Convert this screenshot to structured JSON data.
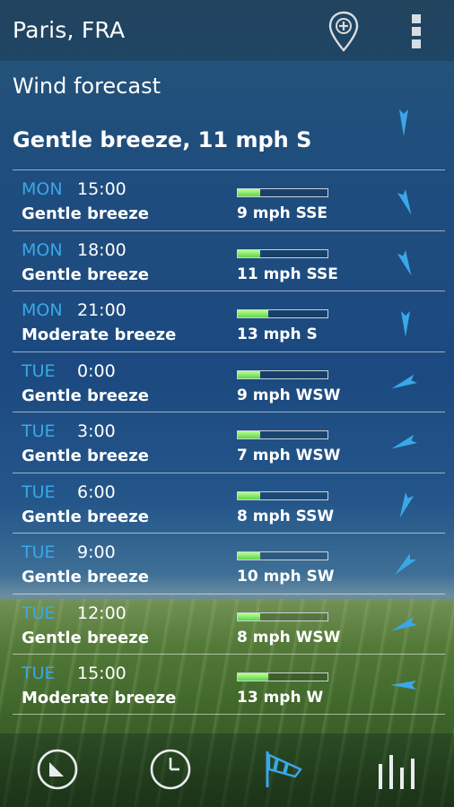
{
  "header": {
    "location": "Paris, FRA",
    "add_location_icon": "add-location-pin-icon",
    "overflow_icon": "overflow-menu-icon"
  },
  "page": {
    "title": "Wind forecast",
    "current_summary": "Gentle breeze, 11 mph S",
    "current_direction": "S"
  },
  "colors": {
    "day_label": "#39a8e8",
    "arrow": "#39a8e8",
    "bar_fill": "#6fe05a",
    "nav_active": "#39a8e8"
  },
  "forecast": [
    {
      "day": "MON",
      "time": "15:00",
      "description": "Gentle breeze",
      "speed_text": "9 mph SSE",
      "direction": "SSE",
      "level": 0.25
    },
    {
      "day": "MON",
      "time": "18:00",
      "description": "Gentle breeze",
      "speed_text": "11 mph SSE",
      "direction": "SSE",
      "level": 0.25
    },
    {
      "day": "MON",
      "time": "21:00",
      "description": "Moderate breeze",
      "speed_text": "13 mph S",
      "direction": "S",
      "level": 0.34
    },
    {
      "day": "TUE",
      "time": "0:00",
      "description": "Gentle breeze",
      "speed_text": "9 mph WSW",
      "direction": "WSW",
      "level": 0.25
    },
    {
      "day": "TUE",
      "time": "3:00",
      "description": "Gentle breeze",
      "speed_text": "7 mph WSW",
      "direction": "WSW",
      "level": 0.25
    },
    {
      "day": "TUE",
      "time": "6:00",
      "description": "Gentle breeze",
      "speed_text": "8 mph SSW",
      "direction": "SSW",
      "level": 0.25
    },
    {
      "day": "TUE",
      "time": "9:00",
      "description": "Gentle breeze",
      "speed_text": "10 mph SW",
      "direction": "SW",
      "level": 0.25
    },
    {
      "day": "TUE",
      "time": "12:00",
      "description": "Gentle breeze",
      "speed_text": "8 mph WSW",
      "direction": "WSW",
      "level": 0.25
    },
    {
      "day": "TUE",
      "time": "15:00",
      "description": "Moderate breeze",
      "speed_text": "13 mph W",
      "direction": "W",
      "level": 0.34
    }
  ],
  "nav": [
    {
      "icon": "current-conditions-dial-icon",
      "active": false
    },
    {
      "icon": "hourly-clock-icon",
      "active": false
    },
    {
      "icon": "windsock-icon",
      "active": true
    },
    {
      "icon": "bar-chart-icon",
      "active": false
    }
  ]
}
